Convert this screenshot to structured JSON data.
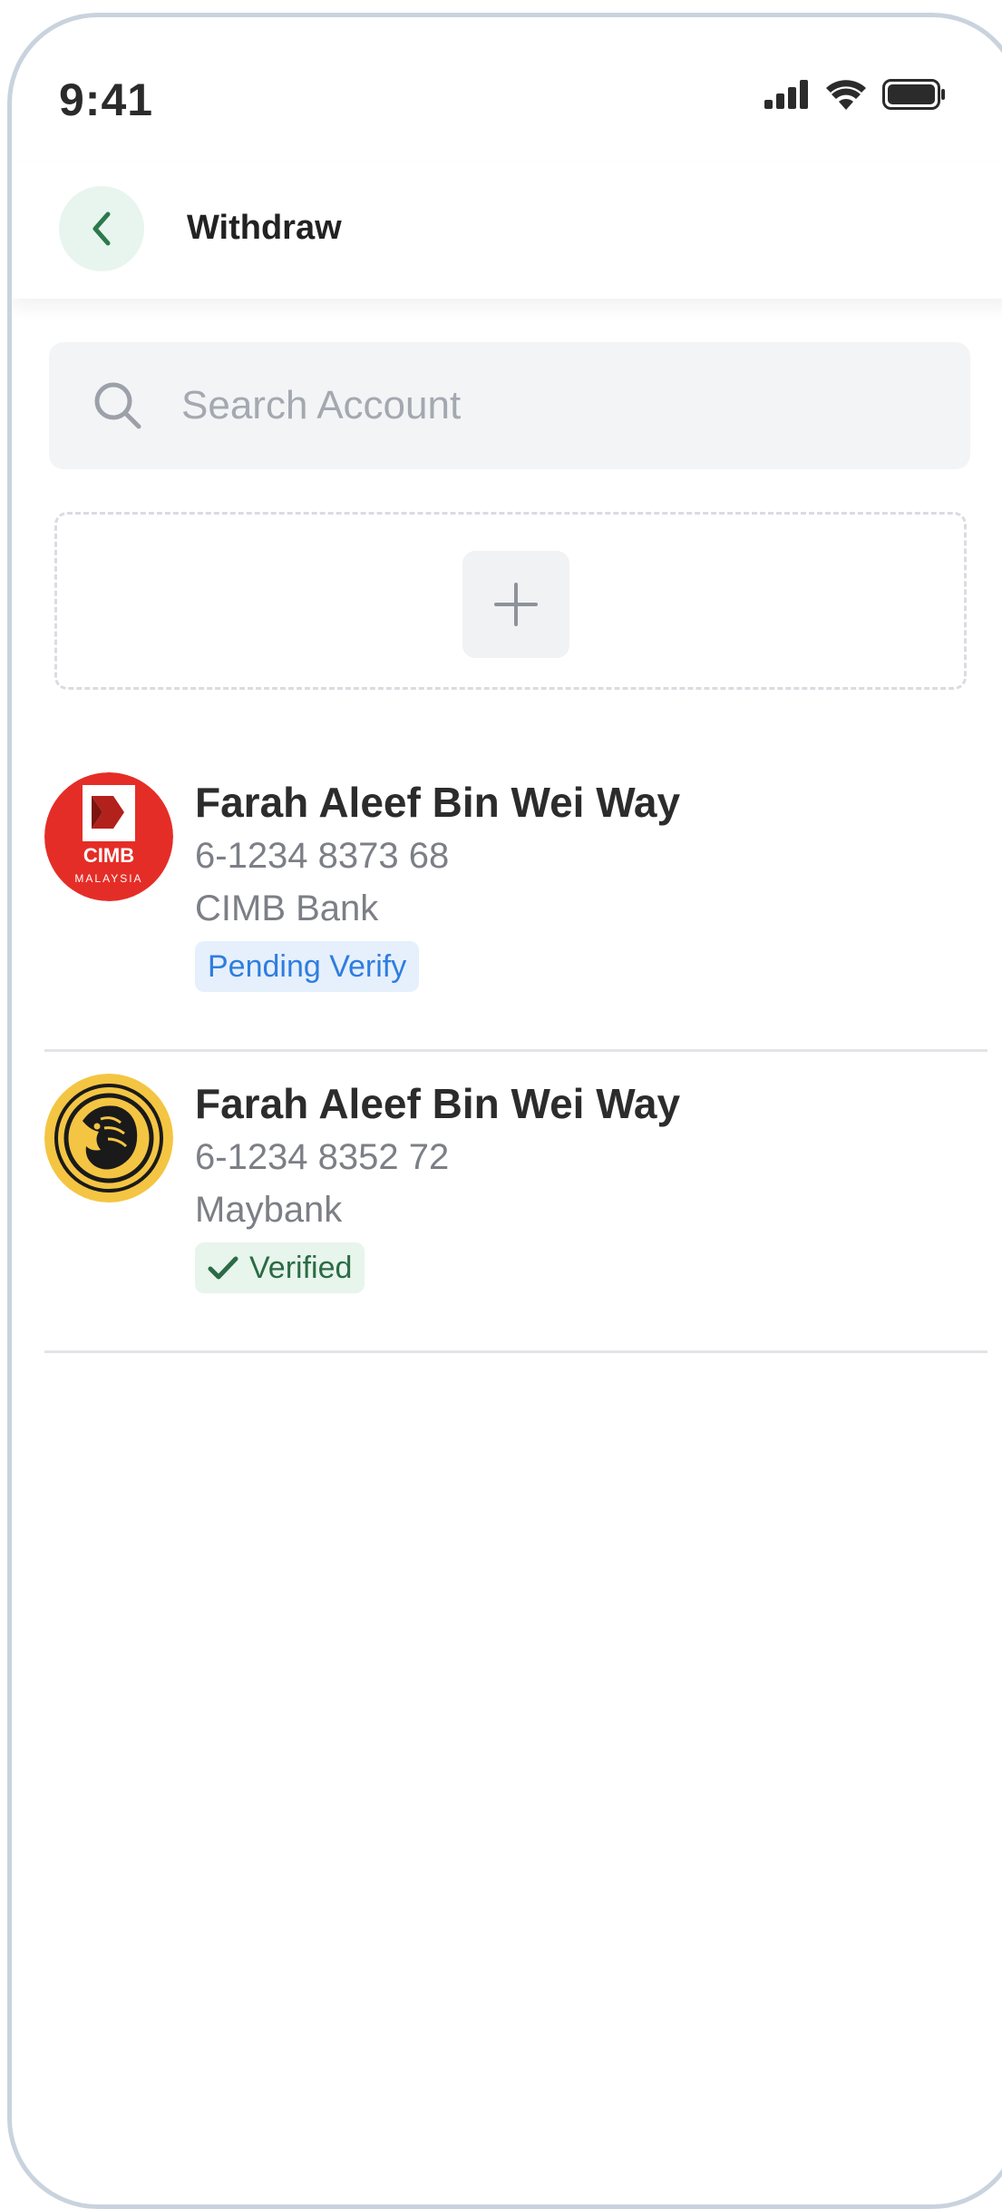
{
  "status_bar": {
    "time": "9:41"
  },
  "header": {
    "title": "Withdraw"
  },
  "search": {
    "placeholder": "Search Account"
  },
  "accounts": [
    {
      "name": "Farah Aleef Bin Wei Way",
      "number": "6-1234 8373 68",
      "bank": "CIMB Bank",
      "status": "Pending Verify",
      "logo": {
        "name": "cimb-logo",
        "text": "CIMB",
        "subtext": "MALAYSIA",
        "color": "#e52d27"
      }
    },
    {
      "name": "Farah Aleef Bin Wei Way",
      "number": "6-1234 8352 72",
      "bank": "Maybank",
      "status": "Verified",
      "logo": {
        "name": "maybank-logo",
        "color": "#f4c543"
      }
    }
  ],
  "colors": {
    "accent": "#2b7a4b",
    "pending": "#2f7de0",
    "verified": "#2b6b45"
  }
}
